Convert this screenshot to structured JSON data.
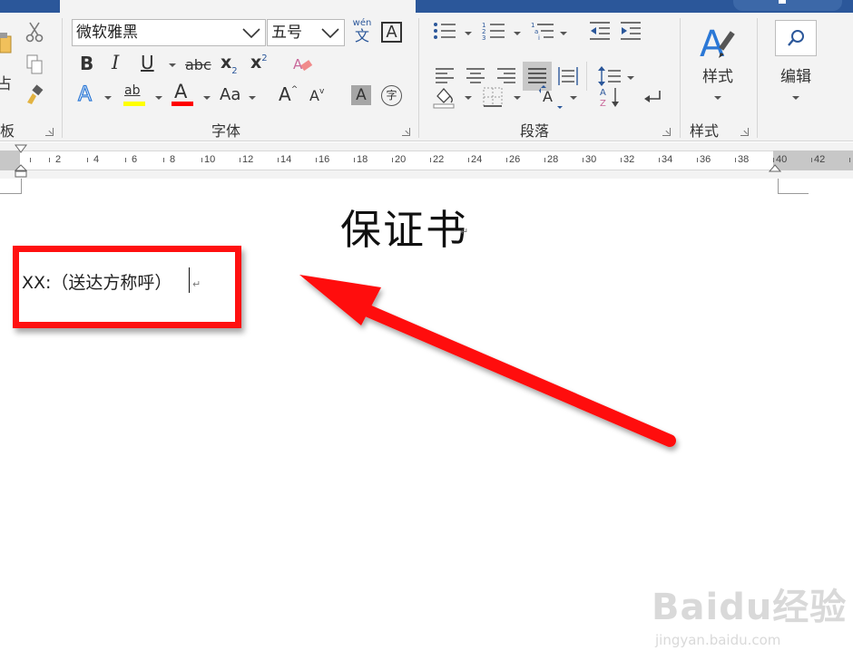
{
  "ribbon": {
    "clipboard": {
      "label_partial": "板",
      "paste_partial": "占"
    },
    "font": {
      "group_label": "字体",
      "font_name": "微软雅黑",
      "font_size": "五号",
      "phonetic_top": "wén",
      "phonetic_bottom": "文",
      "char_border": "A",
      "bold": "B",
      "italic": "I",
      "underline": "U",
      "strikethrough": "abc",
      "subscript": "x",
      "subscript_mark": "2",
      "superscript": "x",
      "superscript_mark": "2",
      "text_effects": "A",
      "highlight": "ab",
      "font_color": "A",
      "change_case": "Aa",
      "grow_font": "A",
      "shrink_font": "A",
      "char_shading": "A",
      "enclose_char": "字",
      "highlight_color": "#ffff00",
      "font_color_value": "#ff0000"
    },
    "paragraph": {
      "group_label": "段落"
    },
    "styles": {
      "group_label": "样式",
      "button_label": "样式"
    },
    "editing": {
      "button_label": "编辑"
    }
  },
  "ruler": {
    "numbers": [
      "2",
      "4",
      "6",
      "8",
      "10",
      "12",
      "14",
      "16",
      "18",
      "20",
      "22",
      "24",
      "26",
      "28",
      "30",
      "32",
      "34",
      "36",
      "38",
      "40",
      "42"
    ]
  },
  "document": {
    "title": "保证书",
    "line1": "XX:（送达方称呼）",
    "paragraph_mark": "↵"
  },
  "watermark": {
    "main": "Baidu经验",
    "sub": "jingyan.baidu.com"
  },
  "colors": {
    "accent": "#2b579a",
    "annotation": "#ff1010"
  }
}
